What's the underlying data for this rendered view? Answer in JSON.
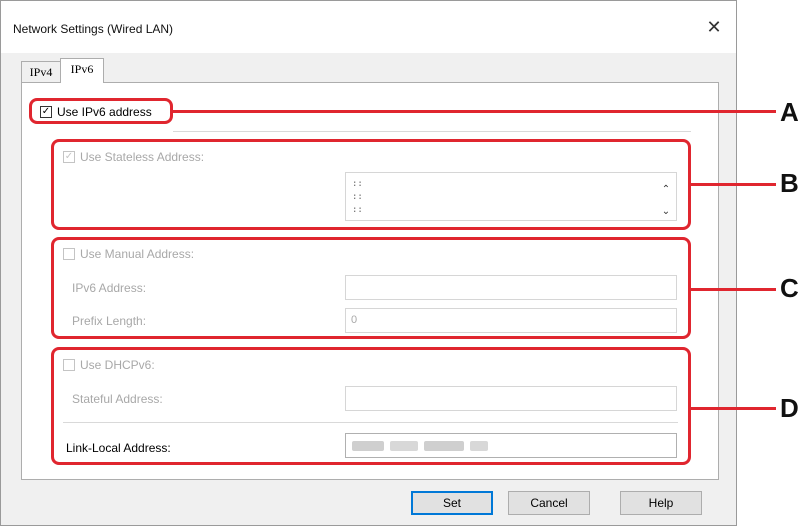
{
  "dialog": {
    "title": "Network Settings (Wired LAN)",
    "close_glyph": "✕"
  },
  "tabs": [
    {
      "label": "IPv4",
      "selected": false
    },
    {
      "label": "IPv6",
      "selected": true
    }
  ],
  "use_ipv6": {
    "label": "Use IPv6 address",
    "checked": true
  },
  "stateless": {
    "label": "Use Stateless Address:",
    "checked": true,
    "enabled": false,
    "list_lines": [
      "::",
      "::",
      "::"
    ]
  },
  "manual": {
    "label": "Use Manual Address:",
    "checked": false,
    "ipv6_address_label": "IPv6 Address:",
    "ipv6_address_value": "",
    "prefix_length_label": "Prefix Length:",
    "prefix_length_value": "0"
  },
  "dhcpv6": {
    "label": "Use DHCPv6:",
    "checked": false,
    "stateful_address_label": "Stateful Address:",
    "stateful_address_value": ""
  },
  "link_local": {
    "label": "Link-Local Address:",
    "value_obscured": true
  },
  "buttons": {
    "set": "Set",
    "cancel": "Cancel",
    "help": "Help"
  },
  "callouts": [
    "A",
    "B",
    "C",
    "D"
  ],
  "colors": {
    "callout_red": "#e0262f",
    "default_button_border": "#0078d7"
  },
  "icons": {
    "close": "close-icon",
    "checkbox_checked": "checkmark-icon",
    "scroll_up": "chevron-up-icon",
    "scroll_down": "chevron-down-icon"
  }
}
